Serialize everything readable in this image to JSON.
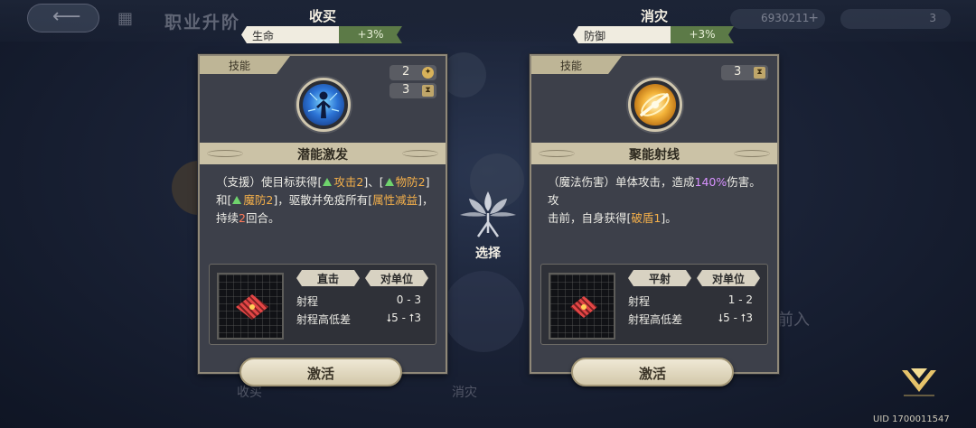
{
  "background": {
    "page_title": "职业升阶",
    "currency_value": "6930211",
    "currency_plus": "+",
    "energy_value": "3",
    "bottom_left_label": "收买",
    "bottom_right_label": "消灾",
    "side_label": "前入"
  },
  "left_option": {
    "title": "收买",
    "stat": {
      "name": "生命",
      "bonus": "+3%"
    },
    "card": {
      "tab_label": "技能",
      "badges": [
        {
          "value": "2",
          "icon": "star-icon"
        },
        {
          "value": "3",
          "icon": "hourglass-icon"
        }
      ],
      "skill_icon": "potential-burst-icon",
      "skill_name": "潜能激发",
      "description": {
        "p1": "（支援）使目标获得[",
        "atk": "攻击2",
        "p2": "]、[",
        "pdef": "物防2",
        "p3": "]",
        "p4": "和[",
        "mdef": "魔防2",
        "p5": "]，驱散并免疫所有[",
        "debuff": "属性减益",
        "p6": "]，",
        "p7": "持续",
        "turns": "2",
        "p8": "回合。"
      },
      "attack_type": "直击",
      "target_type": "对单位",
      "range_label": "射程",
      "range_value": "0 - 3",
      "height_label": "射程高低差",
      "height_value": "⭣5 - ⭡3",
      "activate_label": "激活"
    }
  },
  "right_option": {
    "title": "消灾",
    "stat": {
      "name": "防御",
      "bonus": "+3%"
    },
    "card": {
      "tab_label": "技能",
      "badges": [
        {
          "value": "3",
          "icon": "hourglass-icon"
        }
      ],
      "skill_icon": "focused-beam-icon",
      "skill_name": "聚能射线",
      "description": {
        "p1": "（魔法伤害）单体攻击，造成",
        "pct": "140%",
        "p2": "伤害。攻",
        "p3": "击前，自身获得[",
        "shield": "破盾1",
        "p4": "]。"
      },
      "attack_type": "平射",
      "target_type": "对单位",
      "range_label": "射程",
      "range_value": "1 - 2",
      "height_label": "射程高低差",
      "height_value": "⭣5 - ⭡3",
      "activate_label": "激活"
    }
  },
  "center": {
    "select_label": "选择",
    "emblem_icon": "tree-emblem-icon"
  },
  "footer": {
    "uid": "UID 1700011547",
    "confirm_icon": "chevron-down-icon"
  },
  "colors": {
    "buff_green": "#6fd36d",
    "keyword_orange": "#f5b04a",
    "number_red": "#ff7a5a",
    "percent_purple": "#d892ff",
    "stat_green": "#5c7a47",
    "card_bg": "#3d404a",
    "banner_gold": "#cbc2a6"
  }
}
